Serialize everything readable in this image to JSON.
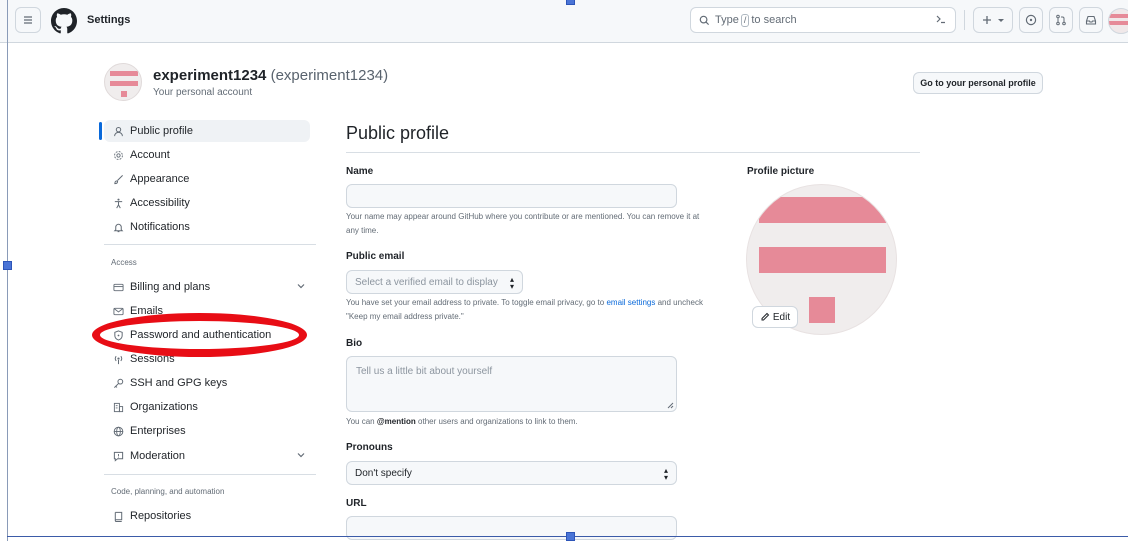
{
  "header": {
    "context": "Settings",
    "search_prefix": "Type",
    "search_key": "/",
    "search_suffix": "to search"
  },
  "account": {
    "name": "experiment1234",
    "login": "(experiment1234)",
    "subtitle": "Your personal account",
    "profile_button": "Go to your personal profile"
  },
  "sidebar": {
    "items": [
      {
        "label": "Public profile",
        "icon": "person-icon"
      },
      {
        "label": "Account",
        "icon": "gear-icon"
      },
      {
        "label": "Appearance",
        "icon": "paintbrush-icon"
      },
      {
        "label": "Accessibility",
        "icon": "accessibility-icon"
      },
      {
        "label": "Notifications",
        "icon": "bell-icon"
      }
    ],
    "access_heading": "Access",
    "access_items": [
      {
        "label": "Billing and plans",
        "icon": "credit-card-icon"
      },
      {
        "label": "Emails",
        "icon": "mail-icon"
      },
      {
        "label": "Password and authentication",
        "icon": "shield-lock-icon"
      },
      {
        "label": "Sessions",
        "icon": "broadcast-icon"
      },
      {
        "label": "SSH and GPG keys",
        "icon": "key-icon"
      },
      {
        "label": "Organizations",
        "icon": "organization-icon"
      },
      {
        "label": "Enterprises",
        "icon": "globe-icon"
      },
      {
        "label": "Moderation",
        "icon": "report-icon"
      }
    ],
    "code_heading": "Code, planning, and automation",
    "code_items": [
      {
        "label": "Repositories",
        "icon": "repo-icon"
      }
    ]
  },
  "main": {
    "title": "Public profile",
    "name_label": "Name",
    "name_value": "",
    "name_note": "Your name may appear around GitHub where you contribute or are mentioned. You can remove it at any time.",
    "email_label": "Public email",
    "email_select": "Select a verified email to display",
    "email_note_1": "You have set your email address to private. To toggle email privacy, go to",
    "email_note_link": "email settings",
    "email_note_2": "and uncheck \"Keep my email address private.\"",
    "bio_label": "Bio",
    "bio_placeholder": "Tell us a little bit about yourself",
    "bio_note_1": "You can",
    "bio_note_mention": "@mention",
    "bio_note_2": "other users and organizations to link to them.",
    "pronouns_label": "Pronouns",
    "pronouns_value": "Don't specify",
    "url_label": "URL",
    "url_value": ""
  },
  "profile_picture": {
    "label": "Profile picture",
    "edit_button": "Edit"
  },
  "colors": {
    "accent": "#0969da",
    "annotation": "#e80d15",
    "identicon": "#e68a98"
  }
}
